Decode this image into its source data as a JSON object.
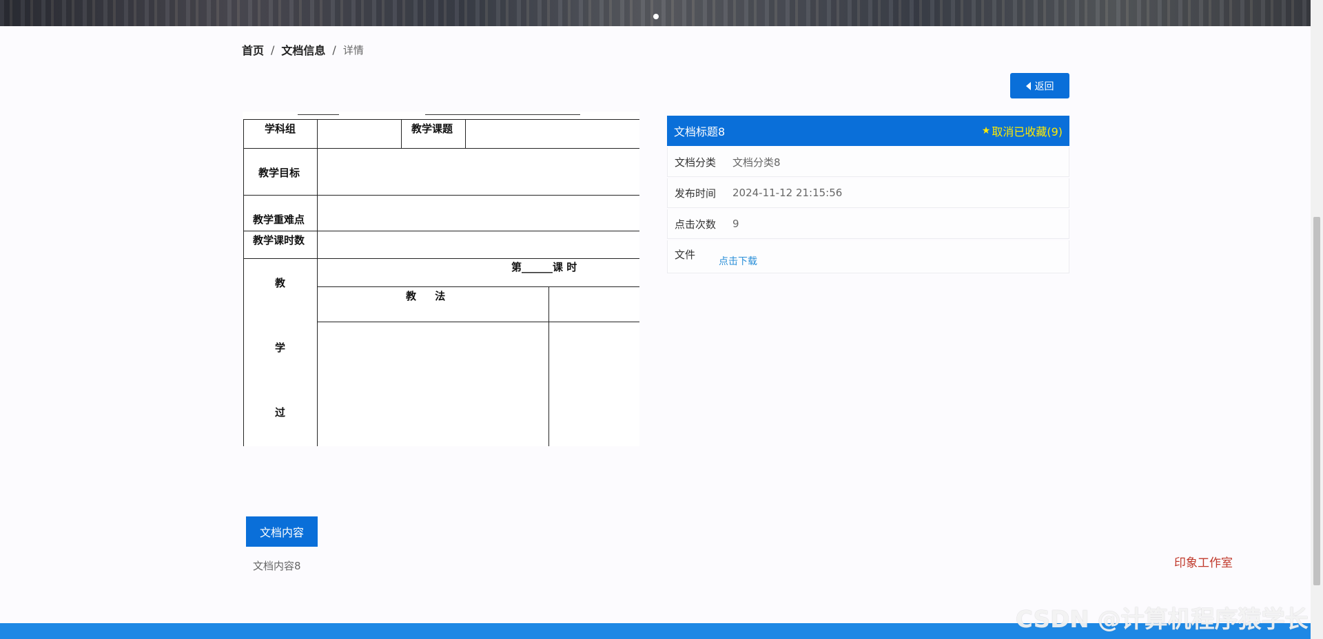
{
  "breadcrumb": {
    "home": "首页",
    "section": "文档信息",
    "current": "详情",
    "sep": "/"
  },
  "back_button": {
    "label": "返回"
  },
  "doc_preview": {
    "cells": {
      "subject_group": "学科组",
      "lesson_topic": "教学课题",
      "goals": "教学目标",
      "key_points": "教学重难点",
      "hours": "教学课时数",
      "lesson_no": "第______课 时",
      "teach_1": "教",
      "method": "教 法",
      "teach_2": "学",
      "teach_3": "过"
    }
  },
  "panel": {
    "title": "文档标题8",
    "favorite": "取消已收藏(9)",
    "rows": [
      {
        "label": "文档分类",
        "value": "文档分类8"
      },
      {
        "label": "发布时间",
        "value": "2024-11-12 21:15:56"
      },
      {
        "label": "点击次数",
        "value": "9"
      }
    ],
    "file_label": "文件",
    "file_link": "点击下载"
  },
  "content": {
    "button": "文档内容",
    "text": "文档内容8"
  },
  "studio": "印象工作室",
  "watermark": "CSDN @计算机程序猿学长",
  "colors": {
    "primary": "#0a6fd9",
    "favorite": "#ffea00",
    "studio": "#c0392b",
    "link": "#2a8fd8"
  }
}
